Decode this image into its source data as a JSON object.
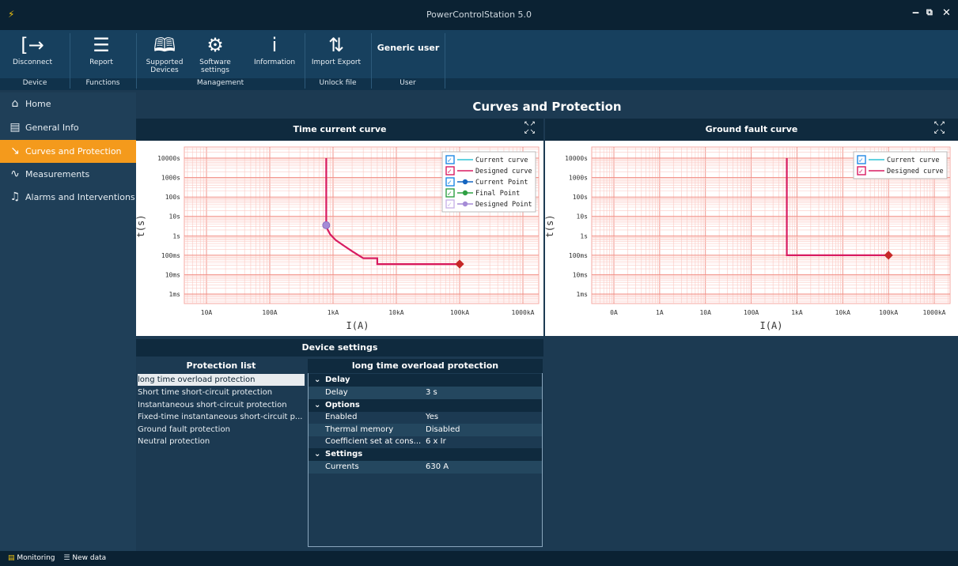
{
  "window": {
    "title": "PowerControlStation 5.0"
  },
  "ribbon": {
    "buttons": [
      {
        "label": "Disconnect",
        "icon": "disconnect-icon"
      },
      {
        "label": "Report",
        "icon": "report-icon"
      },
      {
        "label": "Supported Devices",
        "icon": "book-icon"
      },
      {
        "label": "Software settings",
        "icon": "gear-icon"
      },
      {
        "label": "Information",
        "icon": "info-icon"
      },
      {
        "label": "Import Export",
        "icon": "import-export-icon"
      }
    ],
    "user": "Generic user",
    "groups": [
      "Device",
      "Functions",
      "Management",
      "Unlock file",
      "User"
    ]
  },
  "sidebar": {
    "items": [
      {
        "label": "Home",
        "icon": "home-icon"
      },
      {
        "label": "General Info",
        "icon": "monitor-icon"
      },
      {
        "label": "Curves and Protection",
        "icon": "curve-icon",
        "active": true
      },
      {
        "label": "Measurements",
        "icon": "measurement-icon"
      },
      {
        "label": "Alarms and Interventions",
        "icon": "bell-icon"
      }
    ]
  },
  "main": {
    "title": "Curves and Protection"
  },
  "charts": {
    "time_current": {
      "title": "Time current curve",
      "ylabel": "t(s)",
      "xlabel": "I(A)",
      "yticks": [
        "10000s",
        "1000s",
        "100s",
        "10s",
        "1s",
        "100ms",
        "10ms",
        "1ms"
      ],
      "xticks": [
        "10A",
        "100A",
        "1kA",
        "10kA",
        "100kA",
        "1000kA"
      ],
      "legend": [
        {
          "label": "Current curve",
          "color": "#2ec4d6",
          "checkbox": "#1e88e5"
        },
        {
          "label": "Designed curve",
          "color": "#d81b60",
          "checkbox": "#d81b60"
        },
        {
          "label": "Current Point",
          "color": "#1565c0",
          "checkbox": "#1e88e5"
        },
        {
          "label": "Final Point",
          "color": "#2ea043",
          "checkbox": "#2ea043"
        },
        {
          "label": "Designed Point",
          "color": "#a58bd6",
          "checkbox": "#c9b3e8"
        }
      ]
    },
    "ground_fault": {
      "title": "Ground fault curve",
      "ylabel": "t(s)",
      "xlabel": "I(A)",
      "yticks": [
        "10000s",
        "1000s",
        "100s",
        "10s",
        "1s",
        "100ms",
        "10ms",
        "1ms"
      ],
      "xticks": [
        "0A",
        "1A",
        "10A",
        "100A",
        "1kA",
        "10kA",
        "100kA",
        "1000kA"
      ],
      "legend": [
        {
          "label": "Current curve",
          "color": "#2ec4d6",
          "checkbox": "#1e88e5"
        },
        {
          "label": "Designed curve",
          "color": "#d81b60",
          "checkbox": "#d81b60"
        }
      ]
    }
  },
  "chart_data": [
    {
      "type": "line",
      "title": "Time current curve",
      "xlabel": "I(A)",
      "ylabel": "t(s)",
      "xscale": "log",
      "yscale": "log",
      "xlim": [
        3,
        3000000
      ],
      "ylim": [
        0.0003,
        50000
      ],
      "grid": true,
      "legend_position": "top-right",
      "series": [
        {
          "name": "Designed curve",
          "x": [
            780,
            780,
            800,
            900,
            1100,
            1500,
            2000,
            3000,
            5000,
            5000,
            100000
          ],
          "y": [
            10000,
            3.5,
            2.5,
            1.2,
            0.6,
            0.3,
            0.16,
            0.07,
            0.07,
            0.035,
            0.035
          ]
        }
      ],
      "points": [
        {
          "name": "Designed Point",
          "x": 780,
          "y": 3.5
        },
        {
          "name": "Final Point",
          "x": 100000,
          "y": 0.035
        }
      ]
    },
    {
      "type": "line",
      "title": "Ground fault curve",
      "xlabel": "I(A)",
      "ylabel": "t(s)",
      "xscale": "log",
      "yscale": "log",
      "grid": true,
      "legend_position": "top-right",
      "series": [
        {
          "name": "Designed curve",
          "x": [
            600,
            600,
            100000
          ],
          "y": [
            10000,
            0.1,
            0.1
          ]
        }
      ],
      "points": [
        {
          "name": "Final Point",
          "x": 100000,
          "y": 0.1
        }
      ]
    }
  ],
  "device_settings": {
    "title": "Device settings",
    "protection_list": {
      "title": "Protection list",
      "items": [
        "long time overload protection",
        "Short time short-circuit protection",
        "Instantaneous short-circuit protection",
        "Fixed-time instantaneous short-circuit p...",
        "Ground fault protection",
        "Neutral protection"
      ]
    },
    "properties": {
      "title": "long time overload protection",
      "groups": [
        {
          "name": "Delay",
          "rows": [
            {
              "key": "Delay",
              "value": "3 s"
            }
          ]
        },
        {
          "name": "Options",
          "rows": [
            {
              "key": "Enabled",
              "value": "Yes"
            },
            {
              "key": "Thermal memory",
              "value": "Disabled"
            },
            {
              "key": "Coefficient set at cons...",
              "value": "6 x Ir"
            }
          ]
        },
        {
          "name": "Settings",
          "rows": [
            {
              "key": "Currents",
              "value": "630 A"
            }
          ]
        }
      ]
    }
  },
  "statusbar": {
    "monitoring": "Monitoring",
    "new_data": "New data"
  }
}
